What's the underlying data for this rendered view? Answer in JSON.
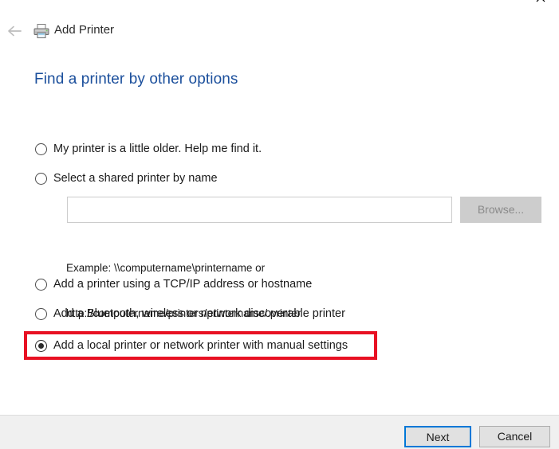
{
  "window": {
    "close_label": "✕",
    "back_icon": "back-arrow-icon",
    "printer_icon": "printer-icon",
    "app_title": "Add Printer"
  },
  "page": {
    "heading": "Find a printer by other options"
  },
  "options": [
    {
      "id": "opt1",
      "label": "My printer is a little older. Help me find it.",
      "checked": false,
      "name": "radio-older-printer"
    },
    {
      "id": "opt2",
      "label": "Select a shared printer by name",
      "checked": false,
      "name": "radio-shared-printer-by-name"
    },
    {
      "id": "opt3",
      "label": "Add a printer using a TCP/IP address or hostname",
      "checked": false,
      "name": "radio-tcpip-printer"
    },
    {
      "id": "opt4",
      "label": "Add a Bluetooth, wireless or network discoverable printer",
      "checked": false,
      "name": "radio-bluetooth-wireless-printer"
    },
    {
      "id": "opt5",
      "label": "Add a local printer or network printer with manual settings",
      "checked": true,
      "name": "radio-local-printer-manual"
    }
  ],
  "shared_printer": {
    "input_value": "",
    "input_placeholder": "",
    "browse_label": "Browse...",
    "example_line1": "Example: \\\\computername\\printername or",
    "example_line2": "http://computername/printers/printername/.printer"
  },
  "footer": {
    "next_label": "Next",
    "cancel_label": "Cancel"
  },
  "colors": {
    "heading_blue": "#1b4f9c",
    "highlight_red": "#e81123",
    "focus_blue": "#0078d7",
    "footer_bg": "#f0f0f0"
  }
}
